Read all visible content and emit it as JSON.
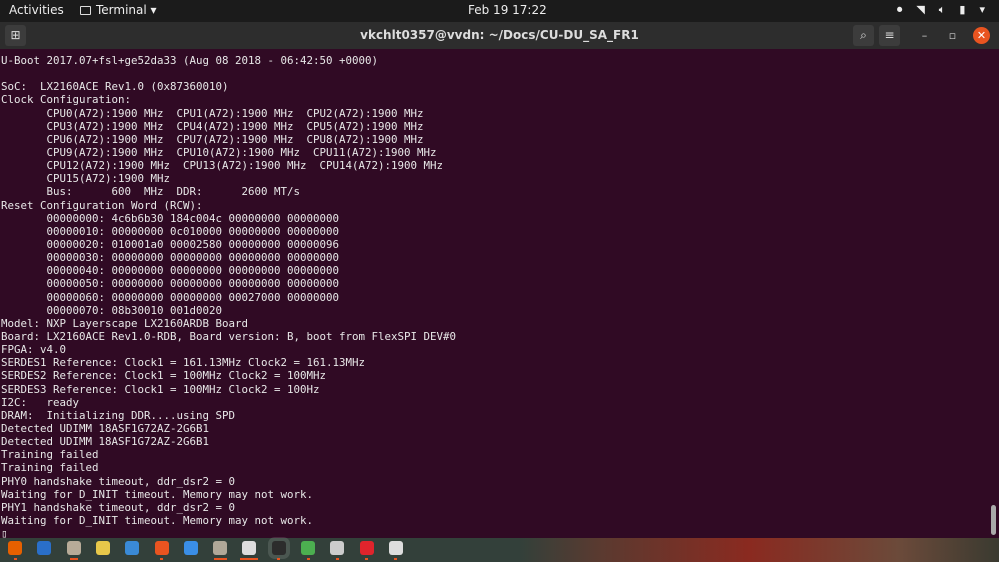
{
  "topbar": {
    "activities": "Activities",
    "app_menu": "Terminal ▾",
    "clock": "Feb 19  17:22"
  },
  "window": {
    "title": "vkchlt0357@vvdn: ~/Docs/CU-DU_SA_FR1"
  },
  "terminal": {
    "lines": [
      "U-Boot 2017.07+fsl+ge52da33 (Aug 08 2018 - 06:42:50 +0000)",
      "",
      "SoC:  LX2160ACE Rev1.0 (0x87360010)",
      "Clock Configuration:",
      "       CPU0(A72):1900 MHz  CPU1(A72):1900 MHz  CPU2(A72):1900 MHz",
      "       CPU3(A72):1900 MHz  CPU4(A72):1900 MHz  CPU5(A72):1900 MHz",
      "       CPU6(A72):1900 MHz  CPU7(A72):1900 MHz  CPU8(A72):1900 MHz",
      "       CPU9(A72):1900 MHz  CPU10(A72):1900 MHz  CPU11(A72):1900 MHz",
      "       CPU12(A72):1900 MHz  CPU13(A72):1900 MHz  CPU14(A72):1900 MHz",
      "       CPU15(A72):1900 MHz",
      "       Bus:      600  MHz  DDR:      2600 MT/s",
      "Reset Configuration Word (RCW):",
      "       00000000: 4c6b6b30 184c004c 00000000 00000000",
      "       00000010: 00000000 0c010000 00000000 00000000",
      "       00000020: 010001a0 00002580 00000000 00000096",
      "       00000030: 00000000 00000000 00000000 00000000",
      "       00000040: 00000000 00000000 00000000 00000000",
      "       00000050: 00000000 00000000 00000000 00000000",
      "       00000060: 00000000 00000000 00027000 00000000",
      "       00000070: 08b30010 001d0020",
      "Model: NXP Layerscape LX2160ARDB Board",
      "Board: LX2160ACE Rev1.0-RDB, Board version: B, boot from FlexSPI DEV#0",
      "FPGA: v4.0",
      "SERDES1 Reference: Clock1 = 161.13MHz Clock2 = 161.13MHz",
      "SERDES2 Reference: Clock1 = 100MHz Clock2 = 100MHz",
      "SERDES3 Reference: Clock1 = 100MHz Clock2 = 100Hz",
      "I2C:   ready",
      "DRAM:  Initializing DDR....using SPD",
      "Detected UDIMM 18ASF1G72AZ-2G6B1",
      "Detected UDIMM 18ASF1G72AZ-2G6B1",
      "Training failed",
      "Training failed",
      "PHY0 handshake timeout, ddr_dsr2 = 0",
      "Waiting for D_INIT timeout. Memory may not work.",
      "PHY1 handshake timeout, ddr_dsr2 = 0",
      "Waiting for D_INIT timeout. Memory may not work.",
      "▯"
    ]
  },
  "dock": {
    "apps": [
      {
        "icon": "firefox-icon",
        "color": "#e66000",
        "running": 1
      },
      {
        "icon": "thunderbird-icon",
        "color": "#2a6fc9",
        "running": 0
      },
      {
        "icon": "files-icon",
        "color": "#b8ab98",
        "running": 2
      },
      {
        "icon": "rhythmbox-icon",
        "color": "#e8c84a",
        "running": 0
      },
      {
        "icon": "writer-icon",
        "color": "#3a8ad6",
        "running": 0
      },
      {
        "icon": "software-icon",
        "color": "#e95420",
        "running": 1
      },
      {
        "icon": "help-icon",
        "color": "#3a8ee6",
        "running": 0
      },
      {
        "icon": "archive-icon",
        "color": "#b0a898",
        "running": 3
      },
      {
        "icon": "document-viewer-icon",
        "color": "#dddddd",
        "running": 4
      },
      {
        "icon": "terminal-icon",
        "color": "#2c2c2c",
        "running": 1
      },
      {
        "icon": "chrome-icon",
        "color": "#4caf50",
        "running": 1
      },
      {
        "icon": "disk-icon",
        "color": "#cccccc",
        "running": 1
      },
      {
        "icon": "alert-icon",
        "color": "#e0242c",
        "running": 1
      },
      {
        "icon": "app-grid-icon",
        "color": "#dddddd",
        "running": 1
      }
    ]
  }
}
